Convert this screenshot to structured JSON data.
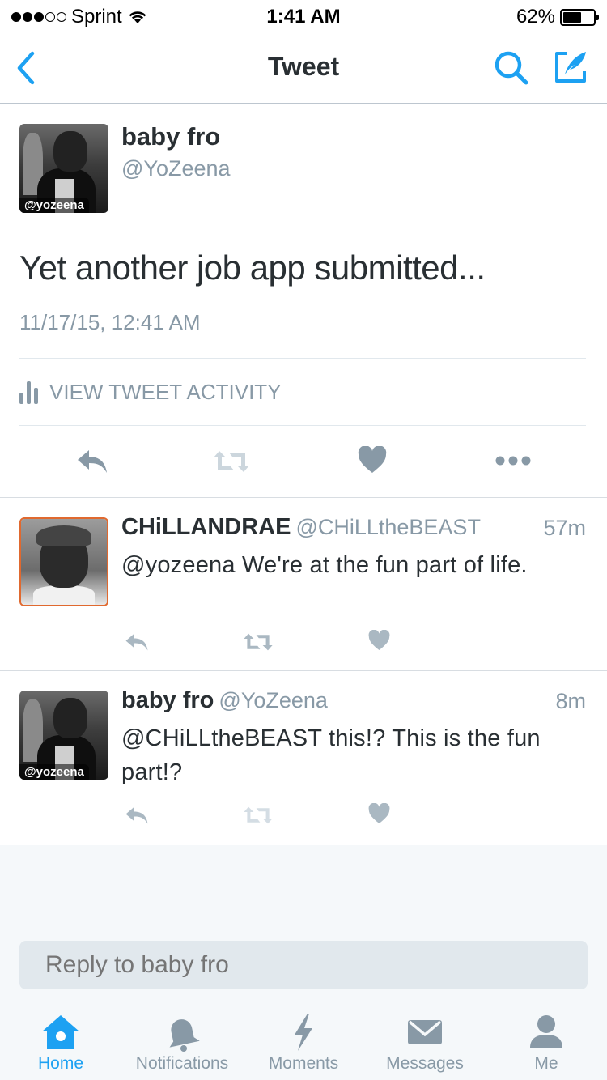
{
  "status_bar": {
    "carrier": "Sprint",
    "time": "1:41 AM",
    "battery": "62%",
    "battery_level": 0.62
  },
  "nav": {
    "title": "Tweet",
    "back_icon": "chevron-left-icon",
    "search_icon": "search-icon",
    "compose_icon": "compose-icon"
  },
  "main_tweet": {
    "name": "baby fro",
    "handle": "@YoZeena",
    "avatar_tag": "@yozeena",
    "text": "Yet another job app submitted...",
    "timestamp": "11/17/15, 12:41 AM",
    "activity_label": "VIEW TWEET ACTIVITY"
  },
  "replies": [
    {
      "name": "CHiLLANDRAE",
      "handle": "@CHiLLtheBEAST",
      "time": "57m",
      "text": "@yozeena We're at the fun part of life."
    },
    {
      "name": "baby fro",
      "handle": "@YoZeena",
      "avatar_tag": "@yozeena",
      "time": "8m",
      "text": "@CHiLLtheBEAST this!? This is the fun part!?"
    }
  ],
  "reply_bar": {
    "placeholder": "Reply to baby fro"
  },
  "tabs": [
    {
      "label": "Home",
      "icon": "home-icon",
      "active": true
    },
    {
      "label": "Notifications",
      "icon": "bell-icon",
      "active": false
    },
    {
      "label": "Moments",
      "icon": "lightning-icon",
      "active": false
    },
    {
      "label": "Messages",
      "icon": "envelope-icon",
      "active": false
    },
    {
      "label": "Me",
      "icon": "person-icon",
      "active": false
    }
  ],
  "colors": {
    "accent": "#1da1f2",
    "icon_gray": "#8899a6",
    "text": "#292f33",
    "background_light": "#f5f8fa"
  }
}
